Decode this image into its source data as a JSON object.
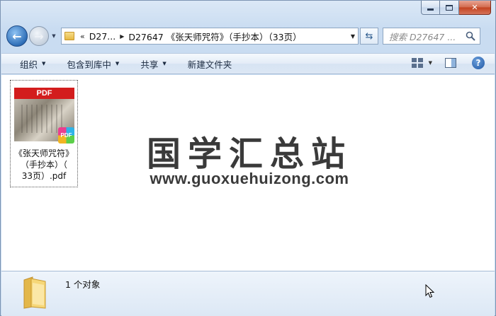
{
  "window": {
    "caption_buttons": [
      "minimize",
      "maximize",
      "close"
    ]
  },
  "navigation": {
    "address_crumbs": [
      "D27...",
      "D27647 《张天师咒符》（手抄本）（33页）"
    ],
    "search_placeholder": "搜索 D27647 ..."
  },
  "toolbar": {
    "organize": "组织",
    "include_in_library": "包含到库中",
    "share": "共享",
    "new_folder": "新建文件夹"
  },
  "file": {
    "thumb_label": "PDF",
    "badge_label": "PDF",
    "name_lines": [
      "《张天师咒符》",
      "（手抄本）（",
      "33页）.pdf"
    ]
  },
  "watermark": {
    "cn": "国学汇总站",
    "url": "www.guoxuehuizong.com"
  },
  "details": {
    "count_text": "1 个对象"
  },
  "colors": {
    "accent": "#2f6fb8",
    "pdf_red": "#d31d1d"
  }
}
